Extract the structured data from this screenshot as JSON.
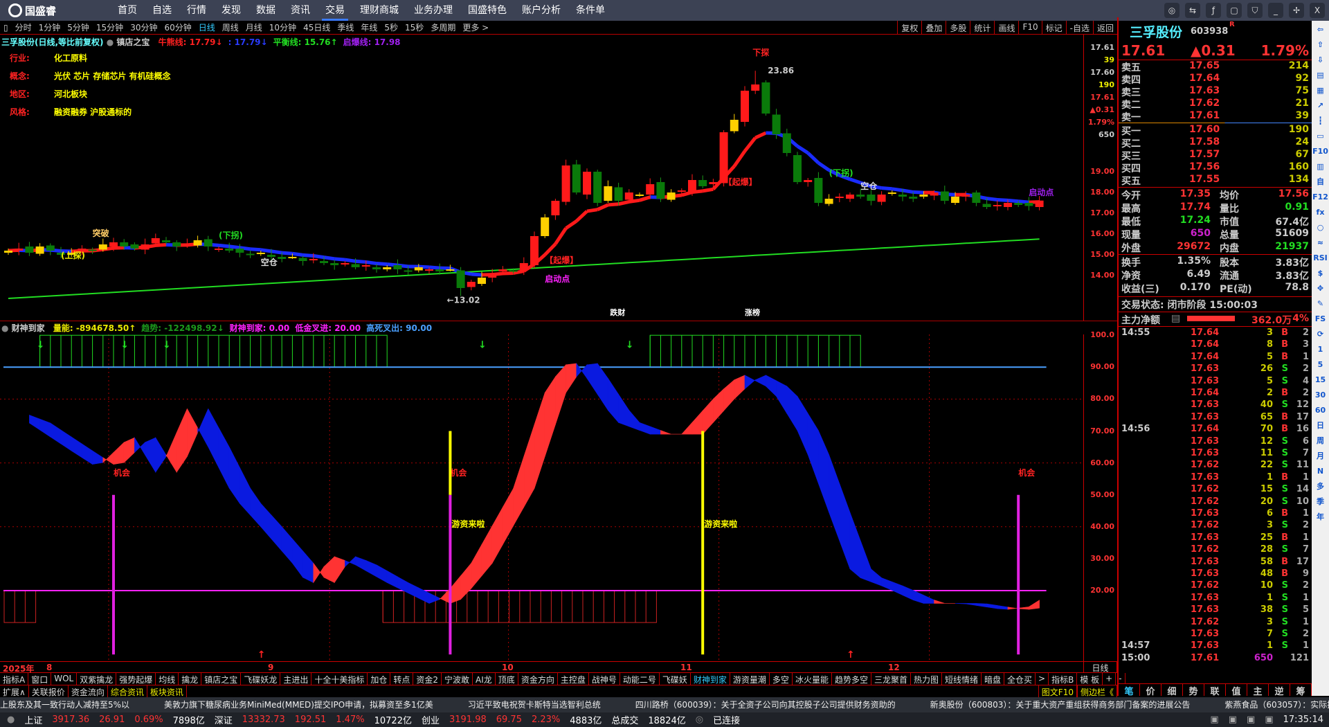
{
  "app": {
    "logo": "国盛睿",
    "menu": [
      "首页",
      "自选",
      "行情",
      "发现",
      "数据",
      "资讯",
      "交易",
      "理财商城",
      "业务办理",
      "国盛特色",
      "账户分析",
      "条件单"
    ],
    "active_menu": "交易",
    "window_controls": [
      "message-icon",
      "settings-icon",
      "function-icon",
      "screen-icon",
      "skin-icon",
      "minimize-icon",
      "restore-icon",
      "close-icon"
    ]
  },
  "toolbar": {
    "periods": [
      "分时",
      "1分钟",
      "5分钟",
      "15分钟",
      "30分钟",
      "60分钟",
      "日线",
      "周线",
      "月线",
      "10分钟",
      "45日线",
      "季线",
      "年线",
      "5秒",
      "15秒",
      "多周期",
      "更多 >"
    ],
    "active": "日线",
    "right": [
      "复权",
      "叠加",
      "多股",
      "统计",
      "画线",
      "F10",
      "标记",
      "-自选",
      "返回"
    ]
  },
  "main": {
    "title": "三孚股份(日线,等比前复权)",
    "indicator": "镇店之宝",
    "lines": [
      {
        "label": "牛熊线: 17.79↓",
        "color": "#ff2020"
      },
      {
        "label": ": 17.79↓",
        "color": "#2a3cff"
      },
      {
        "label": "平衡线: 15.76↑",
        "color": "#22dd22"
      },
      {
        "label": "启爆线: 17.98",
        "color": "#a020f0"
      }
    ],
    "info": [
      {
        "k": "行业:",
        "v": "化工原料"
      },
      {
        "k": "概念:",
        "v": "光伏 芯片 存储芯片 有机硅概念"
      },
      {
        "k": "地区:",
        "v": "河北板块"
      },
      {
        "k": "风格:",
        "v": "融资融券 沪股通标的"
      }
    ],
    "annotations": {
      "high": "23.86",
      "low": "←13.02",
      "down_turn": "(下拐)",
      "up_probe": "(上探)",
      "empty": "空仓",
      "start": "启动点",
      "probe_down": "下探",
      "burst": "【起爆】",
      "breakthrough": "突破",
      "fall_wealth": "跌财",
      "rise_list": "涨榜"
    },
    "axis_ticks": [
      "19.00",
      "18.00",
      "17.00",
      "16.00",
      "15.00",
      "14.00"
    ],
    "axis_quote": [
      "17.61",
      "39",
      "17.60",
      "190",
      "17.61",
      "▲0.31",
      "1.79%",
      "650"
    ]
  },
  "chart_data": {
    "type": "candlestick",
    "months": [
      "8",
      "9",
      "10",
      "11",
      "12"
    ],
    "year": "2025年",
    "closes": [
      15.2,
      15.3,
      15.1,
      15.4,
      15.2,
      15.0,
      15.1,
      15.3,
      15.2,
      15.5,
      15.6,
      15.4,
      15.3,
      15.5,
      15.8,
      15.6,
      15.4,
      15.5,
      15.7,
      15.4,
      15.3,
      15.2,
      15.1,
      15.0,
      15.1,
      14.9,
      14.8,
      14.9,
      14.7,
      14.8,
      14.6,
      14.5,
      14.6,
      14.4,
      14.5,
      14.3,
      14.4,
      14.3,
      14.2,
      14.4,
      14.3,
      14.2,
      14.3,
      13.4,
      13.7,
      13.9,
      14.1,
      14.3,
      14.2,
      14.6,
      15.9,
      16.8,
      17.6,
      19.3,
      18.0,
      19.0,
      17.5,
      18.3,
      17.6,
      18.0,
      17.9,
      18.4,
      17.7,
      18.0,
      18.1,
      18.6,
      18.3,
      18.5,
      20.9,
      21.5,
      22.9,
      23.2,
      21.8,
      20.8,
      19.9,
      18.5,
      18.6,
      17.5,
      17.7,
      17.8,
      17.9,
      17.8,
      17.6,
      17.9,
      18.0,
      17.8,
      17.7,
      17.9,
      18.0,
      17.6,
      17.8,
      17.9,
      17.5,
      17.3,
      17.4,
      17.5,
      17.4,
      17.35,
      17.61
    ],
    "high_value": 23.86,
    "low_value": 13.02,
    "balance_line": [
      12.9,
      15.76
    ],
    "indicator": {
      "name": "财神到家",
      "readouts": [
        {
          "label": "量能: -894678.50↑",
          "color": "#e8e800"
        },
        {
          "label": "趋势: -122498.92↓",
          "color": "#1c9a1c"
        },
        {
          "label": "财神到家: 0.00",
          "color": "#ff22ff"
        },
        {
          "label": "低金叉进: 20.00",
          "color": "#ff22ff"
        },
        {
          "label": "高死叉出: 90.00",
          "color": "#4aa0ff"
        }
      ],
      "ticks": [
        "100.0",
        "90.00",
        "80.00",
        "70.00",
        "60.00",
        "50.00",
        "40.00",
        "30.00",
        "20.00"
      ],
      "keypoints": [
        [
          0,
          75
        ],
        [
          2,
          72.5
        ],
        [
          6,
          63.8
        ],
        [
          8.5,
          58.5
        ],
        [
          11.8,
          69
        ],
        [
          14.2,
          56
        ],
        [
          17,
          77
        ],
        [
          19,
          65
        ],
        [
          21.4,
          49.5
        ],
        [
          24,
          40
        ],
        [
          27,
          28.6
        ],
        [
          28.7,
          21
        ],
        [
          30.7,
          31
        ],
        [
          32.7,
          28.6
        ],
        [
          36,
          22.5
        ],
        [
          40,
          16
        ],
        [
          41.2,
          17.5
        ],
        [
          44,
          28.6
        ],
        [
          48,
          52
        ],
        [
          51.2,
          84
        ],
        [
          53.6,
          93
        ],
        [
          54.9,
          87
        ],
        [
          57.7,
          73
        ],
        [
          61,
          69
        ],
        [
          64,
          69
        ],
        [
          67.4,
          81.5
        ],
        [
          69.7,
          88
        ],
        [
          72.6,
          83
        ],
        [
          75.4,
          68
        ],
        [
          78,
          44.5
        ],
        [
          80.2,
          25
        ],
        [
          83.4,
          21
        ],
        [
          86.7,
          16
        ],
        [
          90.7,
          16
        ],
        [
          94.7,
          14
        ],
        [
          97.2,
          15
        ],
        [
          98,
          17
        ]
      ],
      "high_zones": [
        [
          3,
          36
        ],
        [
          61,
          81
        ]
      ],
      "low_zones": [
        [
          0,
          3
        ],
        [
          36,
          62
        ]
      ],
      "signals": [
        {
          "idx": 10,
          "type": "机会"
        },
        {
          "idx": 42,
          "type": "机会"
        },
        {
          "idx": 96,
          "type": "机会"
        },
        {
          "idx": 42,
          "type": "游资来啦"
        },
        {
          "idx": 66,
          "type": "游资来啦"
        }
      ],
      "down_arrows": [
        3,
        11,
        15,
        45,
        59
      ],
      "up_arrows": [
        24,
        80
      ]
    }
  },
  "quote": {
    "name": "三孚股份",
    "code": "603938",
    "flag": "R",
    "price": "17.61",
    "change": "▲0.31",
    "pct": "1.79%",
    "asks": [
      [
        "卖五",
        "17.65",
        "214"
      ],
      [
        "卖四",
        "17.64",
        "92"
      ],
      [
        "卖三",
        "17.63",
        "75"
      ],
      [
        "卖二",
        "17.62",
        "21"
      ],
      [
        "卖一",
        "17.61",
        "39"
      ]
    ],
    "bids": [
      [
        "买一",
        "17.60",
        "190"
      ],
      [
        "买二",
        "17.58",
        "24"
      ],
      [
        "买三",
        "17.57",
        "67"
      ],
      [
        "买四",
        "17.56",
        "160"
      ],
      [
        "买五",
        "17.55",
        "134"
      ]
    ],
    "stats": [
      [
        "今开",
        "17.35",
        "均价",
        "17.56"
      ],
      [
        "最高",
        "17.74",
        "量比",
        "0.91"
      ],
      [
        "最低",
        "17.24",
        "市值",
        "67.4亿"
      ],
      [
        "现量",
        "650",
        "总量",
        "51609"
      ],
      [
        "外盘",
        "29672",
        "内盘",
        "21937"
      ]
    ],
    "stats2": [
      [
        "换手",
        "1.35%",
        "股本",
        "3.83亿"
      ],
      [
        "净资",
        "6.49",
        "流通",
        "3.83亿"
      ],
      [
        "收益(三)",
        "0.170",
        "PE(动)",
        "78.8"
      ]
    ],
    "trade_status": "交易状态: 闭市阶段 15:00:03",
    "main_net": {
      "label": "主力净额",
      "value": "362.0万",
      "pct": "4%",
      "fill": 0.55
    },
    "ticks": [
      [
        "14:55",
        "17.64",
        "3",
        "B",
        "2"
      ],
      [
        "",
        "17.64",
        "8",
        "B",
        "3"
      ],
      [
        "",
        "17.64",
        "5",
        "B",
        "1"
      ],
      [
        "",
        "17.63",
        "26",
        "S",
        "2"
      ],
      [
        "",
        "17.63",
        "5",
        "S",
        "4"
      ],
      [
        "",
        "17.64",
        "2",
        "B",
        "2"
      ],
      [
        "",
        "17.63",
        "40",
        "S",
        "12"
      ],
      [
        "",
        "17.63",
        "65",
        "B",
        "17"
      ],
      [
        "14:56",
        "17.64",
        "70",
        "B",
        "16"
      ],
      [
        "",
        "17.63",
        "12",
        "S",
        "6"
      ],
      [
        "",
        "17.63",
        "11",
        "S",
        "7"
      ],
      [
        "",
        "17.62",
        "22",
        "S",
        "11"
      ],
      [
        "",
        "17.63",
        "1",
        "B",
        "1"
      ],
      [
        "",
        "17.62",
        "15",
        "S",
        "14"
      ],
      [
        "",
        "17.62",
        "20",
        "S",
        "10"
      ],
      [
        "",
        "17.63",
        "6",
        "B",
        "1"
      ],
      [
        "",
        "17.62",
        "3",
        "S",
        "2"
      ],
      [
        "",
        "17.63",
        "25",
        "B",
        "1"
      ],
      [
        "",
        "17.62",
        "28",
        "S",
        "7"
      ],
      [
        "",
        "17.63",
        "58",
        "B",
        "17"
      ],
      [
        "",
        "17.63",
        "48",
        "B",
        "9"
      ],
      [
        "",
        "17.62",
        "10",
        "S",
        "2"
      ],
      [
        "",
        "17.63",
        "1",
        "S",
        "1"
      ],
      [
        "",
        "17.63",
        "38",
        "S",
        "5"
      ],
      [
        "",
        "17.62",
        "3",
        "S",
        "1"
      ],
      [
        "",
        "17.63",
        "7",
        "S",
        "2"
      ],
      [
        "14:57",
        "17.63",
        "1",
        "S",
        "1"
      ],
      [
        "15:00",
        "17.61",
        "650",
        "",
        "121"
      ]
    ],
    "tabs": [
      "笔",
      "价",
      "细",
      "势",
      "联",
      "值",
      "主",
      "逆",
      "筹"
    ]
  },
  "side_icons": [
    "⇦",
    "⇧",
    "⇩",
    "▤",
    "▦",
    "↗",
    "┇",
    "▭",
    "F10",
    "▥",
    "自",
    "F12",
    "fx",
    "○",
    "≈",
    "RSI",
    "$",
    "✥",
    "✎",
    "FS",
    "⟳",
    "1",
    "5",
    "15",
    "30",
    "60",
    "日",
    "周",
    "月",
    "N",
    "多",
    "季",
    "年"
  ],
  "tabs_row1": [
    "指标A",
    "窗口",
    "WOL",
    "双紫擒龙",
    "强势起爆",
    "均线",
    "擒龙",
    "镇店之宝",
    "飞碟妖龙",
    "主进出",
    "十全十美指标",
    "加仓",
    "转点",
    "资金2",
    "宁波敢",
    "AI龙",
    "顶底",
    "资金方向",
    "主控盘",
    "战神号",
    "动能二号",
    "飞碟妖",
    "财神到家",
    "游资量潮",
    "多空",
    "冰火量能",
    "趋势多空",
    "三龙聚首",
    "热力图",
    "短线情绪",
    "暗盘",
    "全仓买",
    ">",
    "指标B",
    "模 板",
    "+",
    "-"
  ],
  "tabs_row1_active": "财神到家",
  "tabs_row2": [
    "扩展∧",
    "关联报价",
    "资金流向",
    "综合资讯",
    "板块资讯"
  ],
  "tabs_row2_right": [
    "图文F10",
    "侧边栏《"
  ],
  "period_label": "日线",
  "news": [
    "上股东及其一致行动人减持至5%以",
    "美敦力旗下糖尿病业务MiniMed(MMED)提交IPO申请，拟募资至多1亿美",
    "习近平致电祝贺卡斯特当选智利总统",
    "四川路桥（600039）：关于全资子公司向其控股子公司提供财务资助的",
    "新奥股份（600803）：关于重大资产重组获得商务部门备案的进展公告",
    "紫燕食品（603057）：实际控制人及其"
  ],
  "status": {
    "items": [
      [
        "上证",
        "#fff"
      ],
      [
        "3917.36",
        "#f33"
      ],
      [
        "26.91",
        "#f33"
      ],
      [
        "0.69%",
        "#f33"
      ],
      [
        "7898亿",
        "#fff"
      ],
      [
        "深证",
        "#fff"
      ],
      [
        "13332.73",
        "#f33"
      ],
      [
        "192.51",
        "#f33"
      ],
      [
        "1.47%",
        "#f33"
      ],
      [
        "10722亿",
        "#fff"
      ],
      [
        "创业",
        "#fff"
      ],
      [
        "3191.98",
        "#f33"
      ],
      [
        "69.75",
        "#f33"
      ],
      [
        "2.23%",
        "#f33"
      ],
      [
        "4883亿",
        "#fff"
      ],
      [
        "总成交",
        "#fff"
      ],
      [
        "18824亿",
        "#fff"
      ]
    ],
    "connected": "已连接",
    "time": "17:35:14"
  }
}
